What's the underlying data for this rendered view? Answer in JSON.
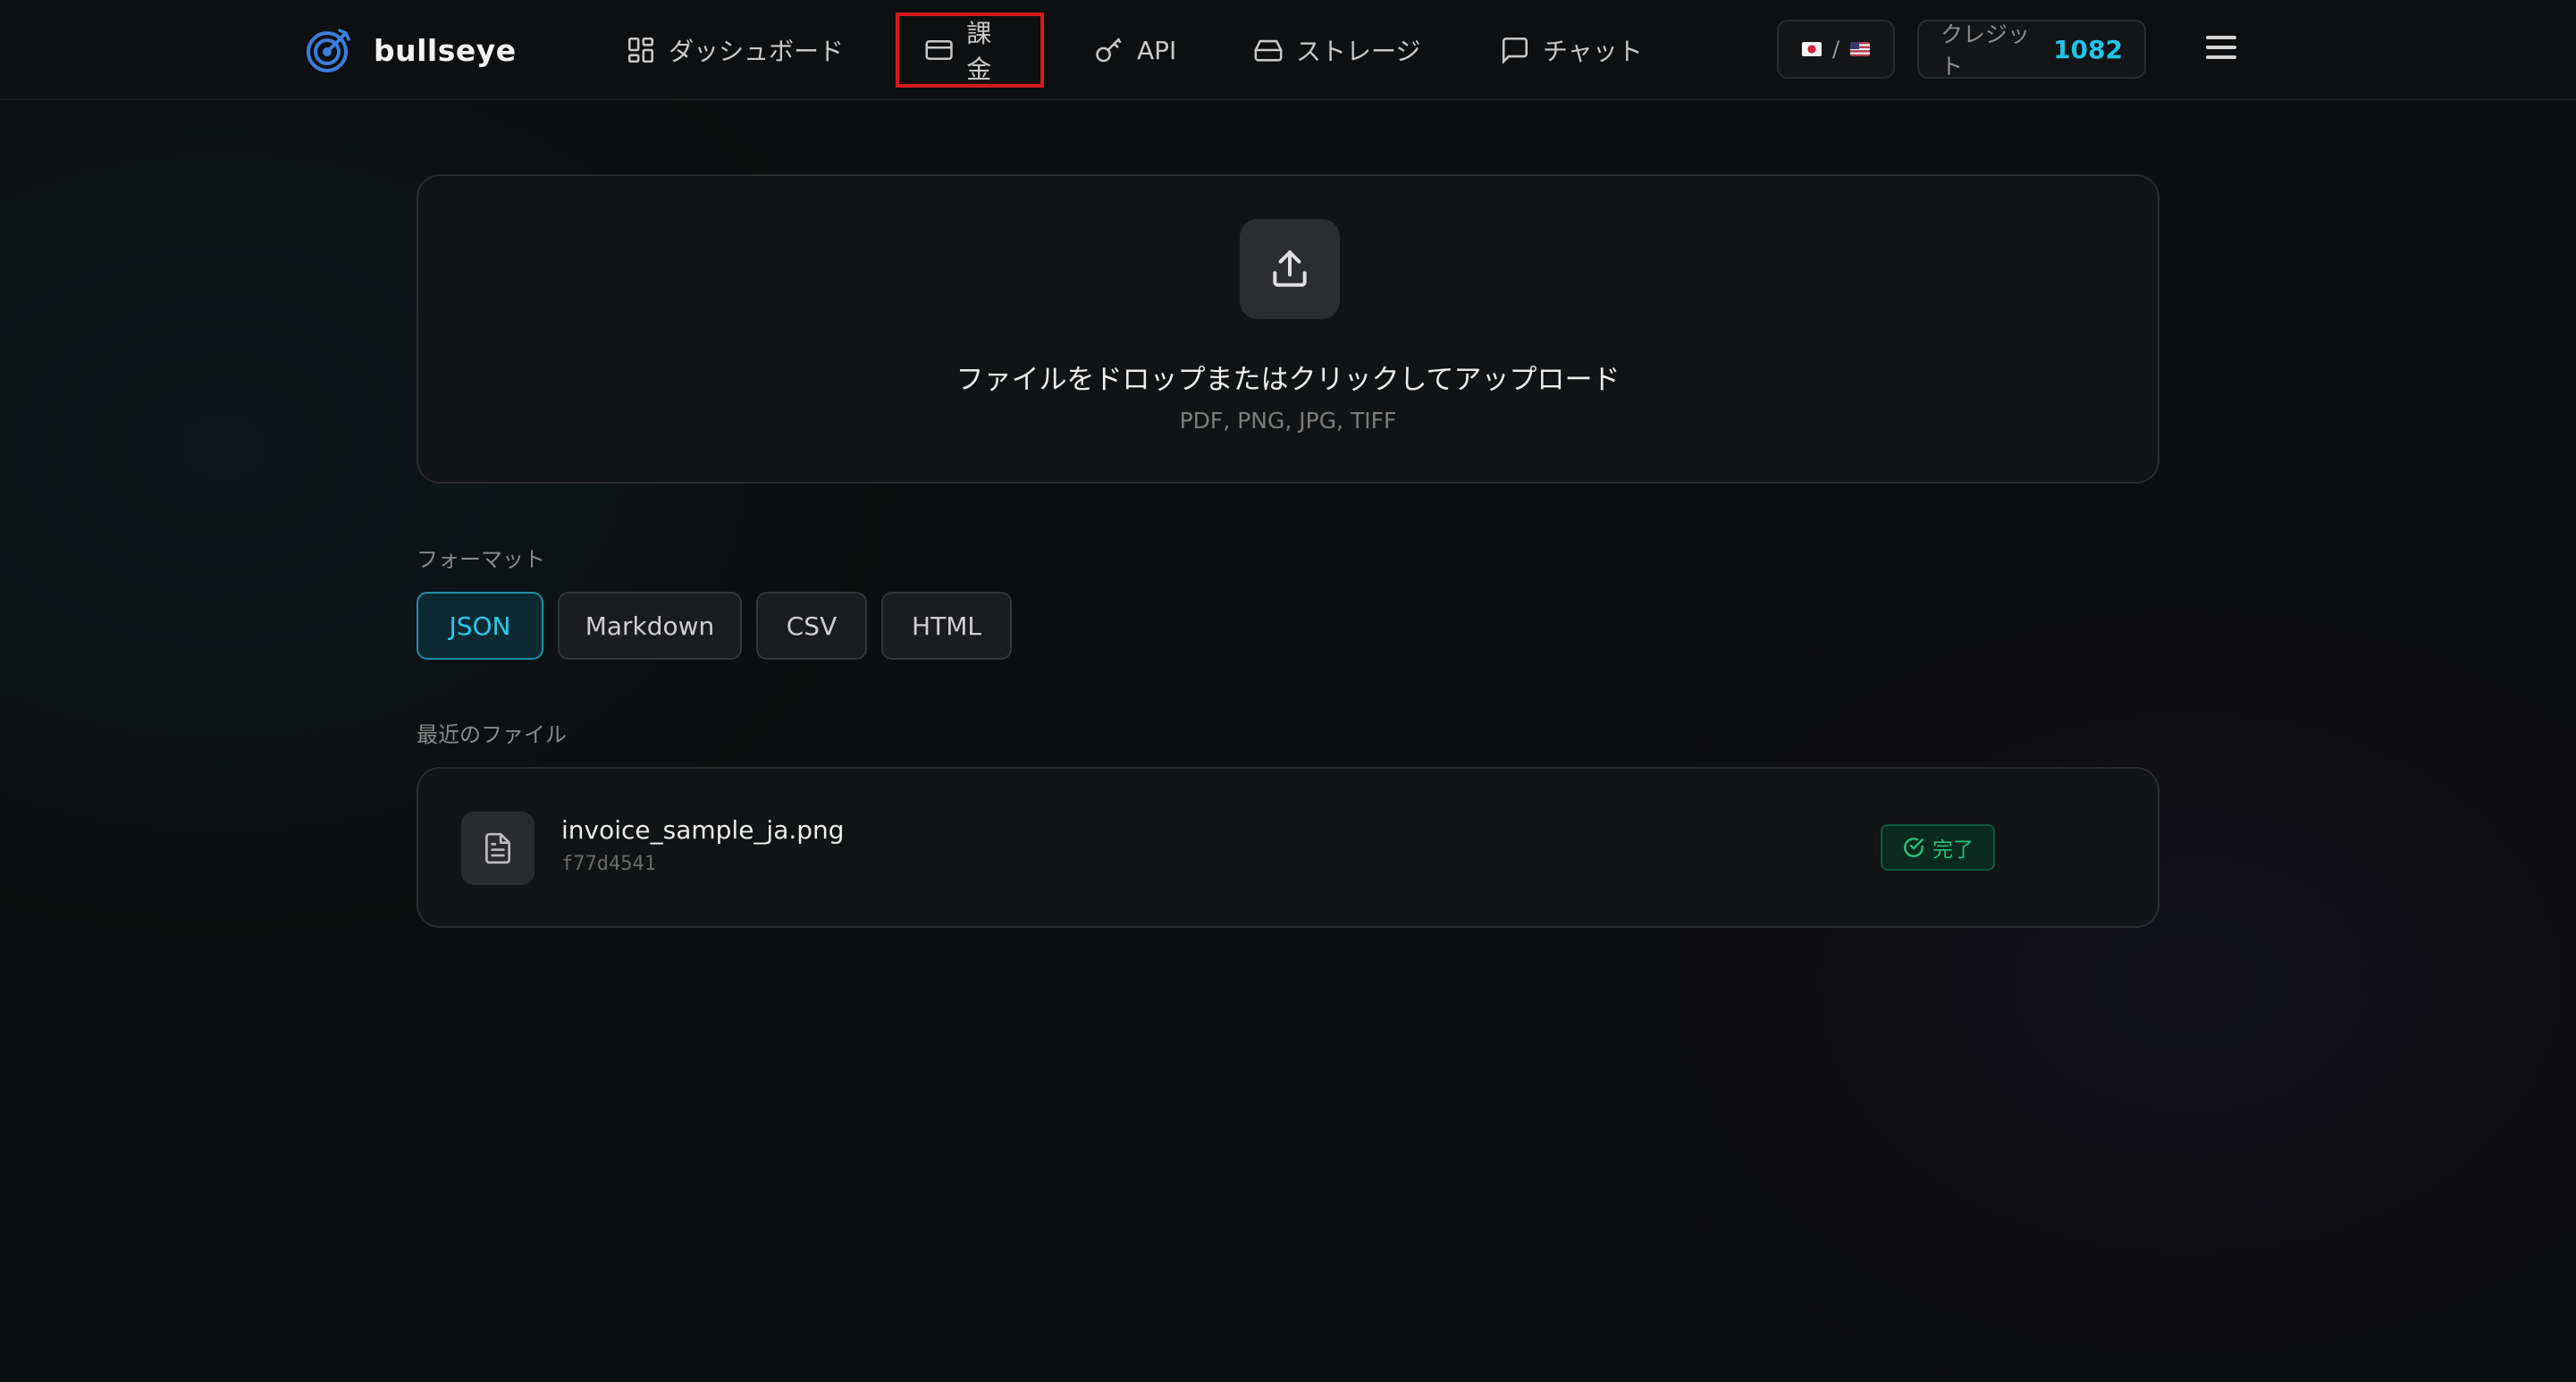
{
  "app": {
    "brand_name": "bullseye",
    "brand_color": "#3b7ddd"
  },
  "nav": [
    {
      "label": "ダッシュボード",
      "icon": "dashboard-grid-icon"
    },
    {
      "label": "課金",
      "icon": "credit-card-icon"
    },
    {
      "label": "API",
      "icon": "key-icon"
    },
    {
      "label": "ストレージ",
      "icon": "hard-drive-icon"
    },
    {
      "label": "チャット",
      "icon": "message-square-icon"
    }
  ],
  "language": {
    "separator": "/",
    "flags": [
      "jp-flag-icon",
      "us-flag-icon"
    ]
  },
  "credits": {
    "label": "クレジット",
    "value": "1082",
    "value_color": "#22c3e6"
  },
  "upload": {
    "title": "ファイルをドロップまたはクリックしてアップロード",
    "subtitle": "PDF, PNG, JPG, TIFF",
    "icon": "upload-icon"
  },
  "format": {
    "label": "フォーマット",
    "options": [
      "JSON",
      "Markdown",
      "CSV",
      "HTML"
    ],
    "selected": "JSON",
    "accent_color": "#2bc8ea"
  },
  "recent": {
    "label": "最近のファイル",
    "files": [
      {
        "name": "invoice_sample_ja.png",
        "id": "f77d4541",
        "status": "完了",
        "status_color": "#2bbf7d",
        "icon": "file-text-icon"
      }
    ]
  }
}
